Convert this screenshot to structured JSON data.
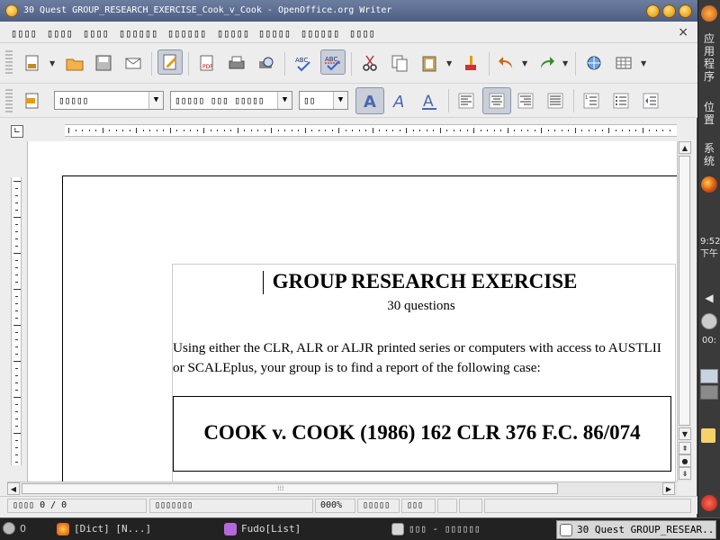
{
  "window": {
    "title": "30 Quest GROUP_RESEARCH_EXERCISE_Cook_v_Cook - OpenOffice.org Writer",
    "close_doc": "×"
  },
  "menubar": {
    "items": [
      "▯▯▯▯",
      "▯▯▯▯",
      "▯▯▯▯",
      "▯▯▯▯▯▯",
      "▯▯▯▯▯▯",
      "▯▯▯▯▯",
      "▯▯▯▯▯",
      "▯▯▯▯▯▯",
      "▯▯▯▯"
    ]
  },
  "format_bar": {
    "style": "▯▯▯▯▯",
    "font": "▯▯▯▯▯ ▯▯▯ ▯▯▯▯▯",
    "size": "▯▯"
  },
  "document": {
    "heading": "GROUP RESEARCH EXERCISE",
    "subheading": "30 questions",
    "instructions": "Using either the CLR, ALR or ALJR printed series or computers with access to AUSTLII or SCALEplus, your group is to find a report of the following case:",
    "case_title": "COOK v. COOK (1986) 162 CLR 376 F.C. 86/074"
  },
  "statusbar": {
    "page": "▯▯▯▯ 0 / 0",
    "style": "▯▯▯▯▯▯▯",
    "zoom": "000%",
    "mode": "▯▯▯▯▯",
    "sel": "▯▯▯"
  },
  "rightpanel": {
    "apps": "应用程序",
    "places": "位置",
    "system": "系统",
    "time": "9:52 下午",
    "counter": "00:"
  },
  "taskbar": {
    "items": [
      {
        "label": "[Dict] [N...]",
        "active": false
      },
      {
        "label": "Fudo[List]",
        "active": false
      },
      {
        "label": "▯▯▯ - ▯▯▯▯▯▯",
        "active": false
      },
      {
        "label": "30 Quest GROUP_RESEAR...",
        "active": true
      }
    ],
    "first_label": "0"
  },
  "colors": {
    "titlebar": "#5a6b90",
    "accent": "#e79a0c",
    "active_button": "#c9ced9"
  }
}
